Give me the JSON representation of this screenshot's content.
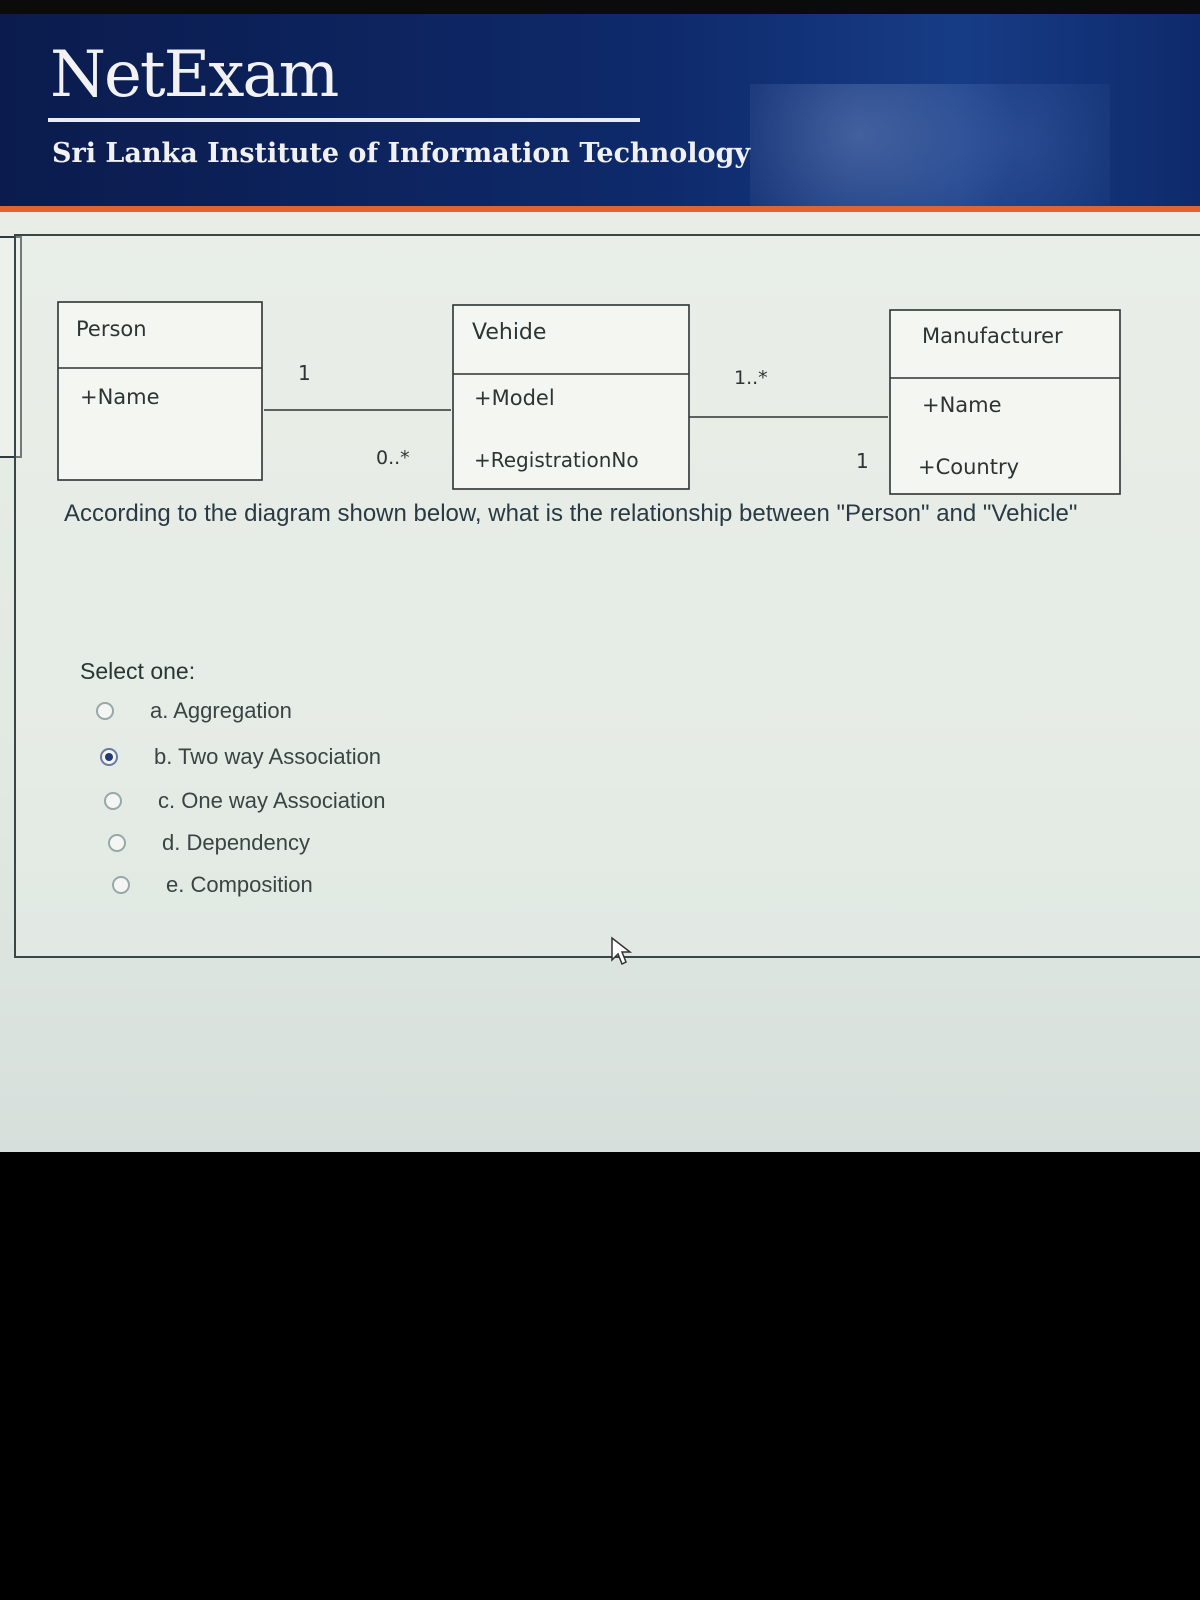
{
  "header": {
    "brand": "NetExam",
    "institution": "Sri Lanka Institute of Information Technology"
  },
  "diagram": {
    "classes": [
      {
        "name": "Person",
        "attributes": [
          "+Name"
        ]
      },
      {
        "name": "Vehide",
        "attributes": [
          "+Model",
          "+RegistrationNo"
        ]
      },
      {
        "name": "Manufacturer",
        "attributes": [
          "+Name",
          "+Country"
        ]
      }
    ],
    "multiplicities": {
      "person_vehicle_person_end": "1",
      "person_vehicle_vehicle_end": "0..*",
      "vehicle_manufacturer_vehicle_end": "1..*",
      "vehicle_manufacturer_manufacturer_end": "1"
    }
  },
  "question": {
    "text": "According to the diagram shown below, what is the relationship between \"Person\" and \"Vehicle\"",
    "select_label": "Select one:",
    "options": [
      {
        "label": "a. Aggregation",
        "selected": false
      },
      {
        "label": "b. Two way Association",
        "selected": true
      },
      {
        "label": "c. One way Association",
        "selected": false
      },
      {
        "label": "d. Dependency",
        "selected": false
      },
      {
        "label": "e. Composition",
        "selected": false
      }
    ]
  },
  "colors": {
    "header_bg": "#0e2a6b",
    "accent": "#e0642f",
    "radio_selected": "#233a78"
  }
}
